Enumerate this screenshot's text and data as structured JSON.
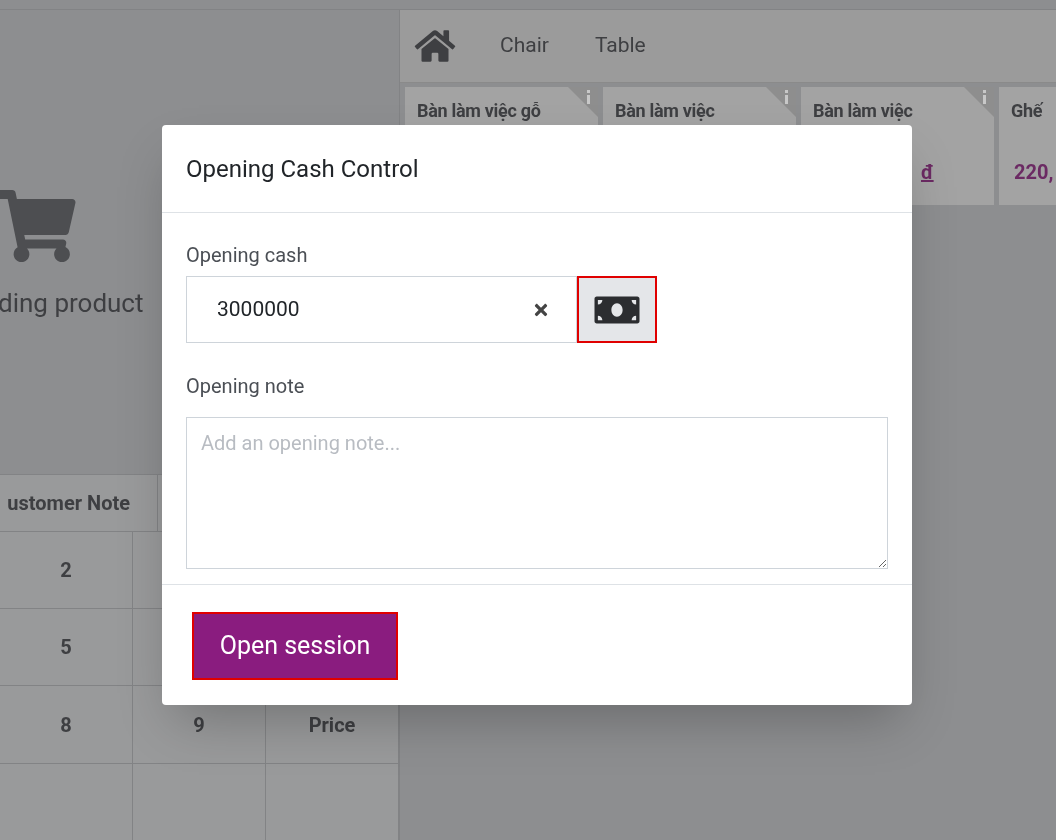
{
  "left_panel": {
    "loading_text": "ding product"
  },
  "numpad": {
    "header": "ustomer Note",
    "rows": [
      [
        "2"
      ],
      [
        "5"
      ],
      [
        "8",
        "9",
        "Price"
      ]
    ]
  },
  "categories": [
    "Chair",
    "Table"
  ],
  "products": [
    {
      "name": "Bàn làm việc gỗ"
    },
    {
      "name": "Bàn làm việc"
    },
    {
      "name": "Bàn làm việc",
      "price": "đ"
    },
    {
      "name": "Ghế",
      "price": "220,"
    }
  ],
  "dialog": {
    "title": "Opening Cash Control",
    "cash_label": "Opening cash",
    "cash_value": "3000000",
    "note_label": "Opening note",
    "note_placeholder": "Add an opening note...",
    "button": "Open session"
  }
}
